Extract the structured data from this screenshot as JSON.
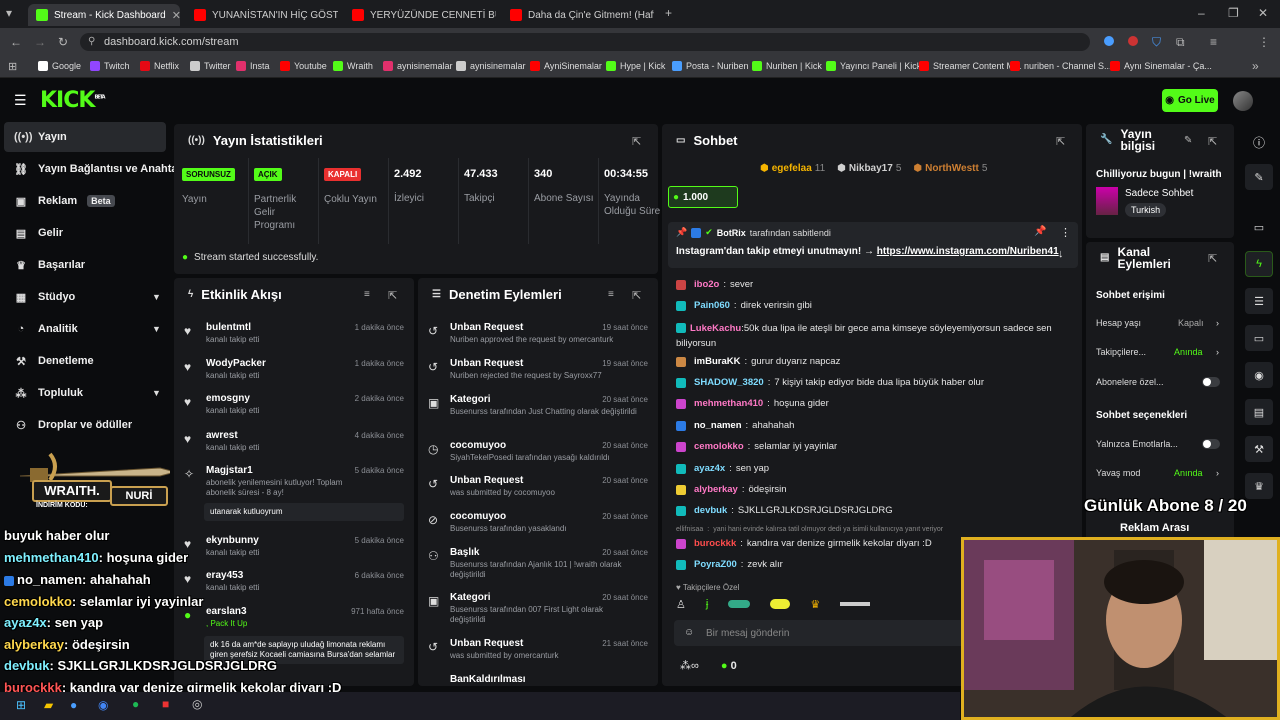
{
  "browser": {
    "tabs": [
      {
        "title": "Stream - Kick Dashboard",
        "icon": "kick-icon",
        "color": "#53fc18"
      },
      {
        "title": "YUNANİSTAN'IN HİÇ GÖSTERİL",
        "icon": "youtube-icon",
        "color": "#ff0000"
      },
      {
        "title": "YERYÜZÜNDE CENNETİ BULDU",
        "icon": "youtube-icon",
        "color": "#ff0000"
      },
      {
        "title": "Daha da Çin'e Gitmem! (Haftalı",
        "icon": "youtube-icon",
        "color": "#ff0000"
      }
    ],
    "url": "dashboard.kick.com/stream",
    "bookmarks": [
      "Google",
      "Twitch",
      "Netflix",
      "Twitter",
      "Insta",
      "Youtube",
      "Wraith",
      "aynisinemalar",
      "aynisinemalar",
      "AyniSinemalar",
      "Hype | Kick",
      "Posta - Nuriben",
      "Nuriben | Kick",
      "Yayıncı Paneli | Kick",
      "Streamer Content M...",
      "nuriben - Channel S...",
      "Aynı Sinemalar - Ça..."
    ]
  },
  "header": {
    "logo": "KICK",
    "logo_beta": "BETA",
    "go_live": "Go Live"
  },
  "sidebar": {
    "items": [
      {
        "label": "Yayın",
        "icon": "broadcast-icon"
      },
      {
        "label": "Yayın Bağlantısı ve Anahtar",
        "icon": "link-icon"
      },
      {
        "label": "Reklam",
        "badge": "Beta",
        "icon": "ad-icon"
      },
      {
        "label": "Gelir",
        "icon": "wallet-icon"
      },
      {
        "label": "Başarılar",
        "icon": "trophy-icon"
      },
      {
        "label": "Stüdyo",
        "icon": "studio-icon"
      },
      {
        "label": "Analitik",
        "icon": "chart-icon"
      },
      {
        "label": "Denetleme",
        "icon": "hammer-icon"
      },
      {
        "label": "Topluluk",
        "icon": "community-icon"
      },
      {
        "label": "Droplar ve ödüller",
        "icon": "gift-icon"
      }
    ]
  },
  "stats": {
    "title": "Yayın İstatistikleri",
    "items": [
      {
        "tag": "SORUNSUZ",
        "label": "Yayın",
        "tag_color": "#53fc18"
      },
      {
        "tag": "AÇIK",
        "label": "Partnerlik Gelir Programı",
        "tag_color": "#53fc18"
      },
      {
        "tag": "KAPALI",
        "label": "Çoklu Yayın",
        "tag_color": "#e9302f"
      },
      {
        "value": "2.492",
        "label": "İzleyici"
      },
      {
        "value": "47.433",
        "label": "Takipçi"
      },
      {
        "value": "340",
        "label": "Abone Sayısı"
      },
      {
        "value": "00:34:55",
        "label": "Yayında Olduğu Süre"
      }
    ],
    "success": "Stream started successfully."
  },
  "activity": {
    "title": "Etkinlik Akışı",
    "items": [
      {
        "name": "bulentmtl",
        "sub": "kanalı takip etti",
        "time": "1 dakika önce"
      },
      {
        "name": "WodyPacker",
        "sub": "kanalı takip etti",
        "time": "1 dakika önce"
      },
      {
        "name": "emosgny",
        "sub": "kanalı takip etti",
        "time": "2 dakika önce"
      },
      {
        "name": "awrest",
        "sub": "kanalı takip etti",
        "time": "4 dakika önce"
      },
      {
        "name": "Magjstar1",
        "sub": "abonelik yenilemesini kutluyor! Toplam abonelik süresi - 8 ay!",
        "time": "5 dakika önce",
        "message": "utanarak kutluoyrum"
      },
      {
        "name": "ekynbunny",
        "sub": "kanalı takip etti",
        "time": "5 dakika önce"
      },
      {
        "name": "eray453",
        "sub": "kanalı takip etti",
        "time": "6 dakika önce"
      },
      {
        "name": "earslan3",
        "sub": ", Pack It Up",
        "time": "971 hafta önce",
        "message": "dk 16 da am*de saplayıp uludağ limonata reklamı giren şerefsiz Kocaeli camiasına Bursa'dan selamlar"
      }
    ]
  },
  "moderation": {
    "title": "Denetim Eylemleri",
    "items": [
      {
        "name": "Unban Request",
        "sub": "Nuriben approved the request by omercanturk",
        "time": "19 saat önce"
      },
      {
        "name": "Unban Request",
        "sub": "Nuriben rejected the request by Sayroxx77",
        "time": "19 saat önce"
      },
      {
        "name": "Kategori",
        "sub": "Busenurss tarafından Just Chatting olarak değiştirildi",
        "time": "20 saat önce"
      },
      {
        "name": "cocomuyoo",
        "sub": "SiyahTekelPosedi tarafından yasağı kaldırıldı",
        "time": "20 saat önce"
      },
      {
        "name": "Unban Request",
        "sub": "was submitted by cocomuyoo",
        "time": "20 saat önce"
      },
      {
        "name": "cocomuyoo",
        "sub": "Busenurss tarafından yasaklandı",
        "time": "20 saat önce"
      },
      {
        "name": "Başlık",
        "sub": "Busenurss tarafından Ajanlık 101 | !wraith olarak değiştirildi",
        "time": "20 saat önce"
      },
      {
        "name": "Kategori",
        "sub": "Busenurss tarafından 007 First Light olarak değiştirildi",
        "time": "20 saat önce"
      },
      {
        "name": "Unban Request",
        "sub": "was submitted by omercanturk",
        "time": "21 saat önce"
      },
      {
        "name": "BanKaldırılması",
        "sub": "",
        "time": ""
      }
    ]
  },
  "chat": {
    "title": "Sohbet",
    "top_gifters": [
      {
        "name": "egefelaa",
        "count": "11"
      },
      {
        "name": "Nikbay17",
        "count": "5"
      },
      {
        "name": "NorthWestt",
        "count": "5"
      }
    ],
    "goal": "1.000",
    "pinned_by": "BotRix",
    "pinned_label": "tarafından sabitlendi",
    "pinned_text": "Instagram'dan takip etmeyi unutmayın! →",
    "pinned_link": "https://www.instagram.com/Nuriben41",
    "messages": [
      {
        "user": "ibo2o",
        "text": "sever",
        "color": "#ff79c6"
      },
      {
        "user": "Pain060",
        "text": "direk verirsin gibi",
        "color": "#7fdcff"
      },
      {
        "user": "LukeKachu",
        "text": "50k dua lipa ile ateşli bir gece ama kimseye söyleyemiyorsun sadece sen biliyorsun",
        "color": "#ff79c6"
      },
      {
        "user": "imBuraKK",
        "text": "gurur duyarız napcaz",
        "color": "#ffffff"
      },
      {
        "user": "SHADOW_3820",
        "text": "7 kişiyi takip ediyor bide dua lipa büyük haber olur",
        "color": "#7fdcff"
      },
      {
        "user": "mehmethan410",
        "text": "hoşuna gider",
        "color": "#ff79c6"
      },
      {
        "user": "no_namen",
        "text": "ahahahah",
        "color": "#ffffff"
      },
      {
        "user": "cemolokko",
        "text": "selamlar iyi yayinlar",
        "color": "#ff79c6"
      },
      {
        "user": "ayaz4x",
        "text": "sen yap",
        "color": "#7fdcff"
      },
      {
        "user": "alyberkay",
        "text": "ödeşirsin",
        "color": "#ff79c6"
      },
      {
        "user": "devbuk",
        "text": "SJKLLGRJLKDSRJGLDSRJGLDRG",
        "color": "#7fdcff"
      },
      {
        "user": "ellifnisaa",
        "text": "yani hani evinde kalırsa tatil olmuyor dedi ya isimli kullanıcıya yanıt veriyor",
        "color": "#888888"
      },
      {
        "user": "burockkk",
        "text": "kandıra var denize girmelik kekolar diyarı :D",
        "color": "#ff4d4d"
      },
      {
        "user": "PoyraZ00",
        "text": "zevk alır",
        "color": "#7fdcff"
      }
    ],
    "followers_only": "Takipçilere Özel",
    "input_placeholder": "Bir mesaj gönderin",
    "bottom_count": "0"
  },
  "stream_info": {
    "title": "Yayın bilgisi",
    "stream_title": "Chilliyoruz bugun | !wraith",
    "category": "Sadece Sohbet",
    "language": "Turkish"
  },
  "channel_actions": {
    "title": "Kanal Eylemleri",
    "chat_access": "Sohbet erişimi",
    "rows": [
      {
        "label": "Hesap yaşı",
        "value": "Kapalı"
      },
      {
        "label": "Takipçilere...",
        "value": "Anında"
      },
      {
        "label": "Abonelere özel..."
      }
    ],
    "chat_options": "Sohbet seçenekleri",
    "rows2": [
      {
        "label": "Yalnızca Emotlarla..."
      },
      {
        "label": "Yavaş mod",
        "value": "Anında"
      }
    ],
    "ad_break": "Reklam Arası"
  },
  "overlay": {
    "sub_goal": "Günlük Abone 8 / 20",
    "wraith_label": "WRAITH.",
    "wraith_code_label": "İNDİRİM KODU:",
    "wraith_code": "NURİ",
    "lines": [
      {
        "user": "",
        "text": "buyuk haber olur"
      },
      {
        "user": "mehmethan410",
        "text": ": hoşuna gider"
      },
      {
        "user": "no_namen",
        "text": ": ahahahah"
      },
      {
        "user": "cemolokko",
        "text": ": selamlar iyi yayinlar"
      },
      {
        "user": "ayaz4x",
        "text": ": sen yap"
      },
      {
        "user": "alyberkay",
        "text": ": ödeşirsin"
      },
      {
        "user": "devbuk",
        "text": ": SJKLLGRJLKDSRJGLDSRJGLDRG"
      },
      {
        "user": "burockkk",
        "text": ": kandıra var denize girmelik kekolar diyarı :D"
      },
      {
        "user": "PoyraZ00",
        "text": ": zevk alır"
      }
    ]
  }
}
